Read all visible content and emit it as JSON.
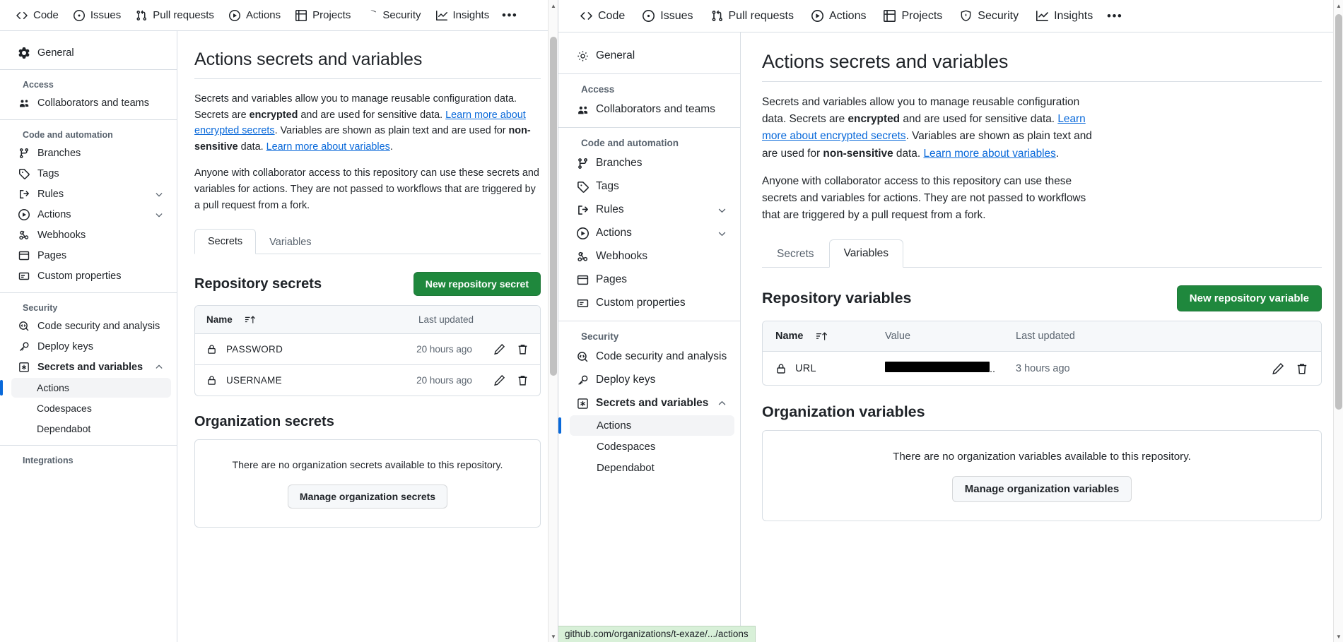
{
  "repo_nav": {
    "items": [
      {
        "label": "Code",
        "icon": "code-icon"
      },
      {
        "label": "Issues",
        "icon": "issue-opened-icon"
      },
      {
        "label": "Pull requests",
        "icon": "git-pull-request-icon"
      },
      {
        "label": "Actions",
        "icon": "play-icon"
      },
      {
        "label": "Projects",
        "icon": "table-icon"
      },
      {
        "label": "Security",
        "icon": "shield-icon"
      },
      {
        "label": "Insights",
        "icon": "graph-icon"
      }
    ],
    "more_label": "•••"
  },
  "sidebar": {
    "general": {
      "label": "General",
      "icon": "gear-icon"
    },
    "groups": [
      {
        "label": "Access",
        "items": [
          {
            "label": "Collaborators and teams",
            "icon": "people-icon",
            "chevron": false
          }
        ]
      },
      {
        "label": "Code and automation",
        "items": [
          {
            "label": "Branches",
            "icon": "git-branch-icon",
            "chevron": false
          },
          {
            "label": "Tags",
            "icon": "tag-icon",
            "chevron": false
          },
          {
            "label": "Rules",
            "icon": "rules-icon",
            "chevron": true
          },
          {
            "label": "Actions",
            "icon": "play-icon",
            "chevron": true
          },
          {
            "label": "Webhooks",
            "icon": "webhook-icon",
            "chevron": false
          },
          {
            "label": "Pages",
            "icon": "browser-icon",
            "chevron": false
          },
          {
            "label": "Custom properties",
            "icon": "note-icon",
            "chevron": false
          }
        ]
      },
      {
        "label": "Security",
        "items": [
          {
            "label": "Code security and analysis",
            "icon": "codescan-icon",
            "chevron": false
          },
          {
            "label": "Deploy keys",
            "icon": "key-icon",
            "chevron": false
          },
          {
            "label": "Secrets and variables",
            "icon": "asterisk-icon",
            "chevron": true,
            "bold": true
          }
        ],
        "subitems": [
          {
            "label": "Actions",
            "active": true
          },
          {
            "label": "Codespaces",
            "active": false
          },
          {
            "label": "Dependabot",
            "active": false
          }
        ]
      },
      {
        "label": "Integrations",
        "items": []
      }
    ]
  },
  "page": {
    "title": "Actions secrets and variables",
    "desc1_a": "Secrets and variables allow you to manage reusable configuration data. Secrets are ",
    "desc1_b": "encrypted",
    "desc1_c": " and are used for sensitive data. ",
    "desc1_link1": "Learn more about encrypted secrets",
    "desc1_d": ". Variables are shown as plain text and are used for ",
    "desc1_e": "non-sensitive",
    "desc1_f": " data. ",
    "desc1_link2": "Learn more about variables",
    "desc1_g": ".",
    "desc2": "Anyone with collaborator access to this repository can use these secrets and variables for actions. They are not passed to workflows that are triggered by a pull request from a fork."
  },
  "tabs": {
    "secrets": "Secrets",
    "variables": "Variables"
  },
  "left_panel": {
    "active_tab": "Secrets",
    "secrets_section": {
      "title": "Repository secrets",
      "new_button": "New repository secret",
      "columns": {
        "name": "Name",
        "last_updated": "Last updated"
      },
      "rows": [
        {
          "name": "PASSWORD",
          "last_updated": "20 hours ago",
          "icon": "lock-icon"
        },
        {
          "name": "USERNAME",
          "last_updated": "20 hours ago",
          "icon": "lock-icon"
        }
      ]
    },
    "org_section": {
      "title": "Organization secrets",
      "empty_text": "There are no organization secrets available to this repository.",
      "manage_button": "Manage organization secrets"
    }
  },
  "right_panel": {
    "active_tab": "Variables",
    "variables_section": {
      "title": "Repository variables",
      "new_button": "New repository variable",
      "columns": {
        "name": "Name",
        "value": "Value",
        "last_updated": "Last updated"
      },
      "rows": [
        {
          "name": "URL",
          "value": "",
          "value_redacted": true,
          "value_suffix": "..",
          "last_updated": "3 hours ago",
          "icon": "lock-icon"
        }
      ]
    },
    "org_section": {
      "title": "Organization variables",
      "empty_text": "There are no organization variables available to this repository.",
      "manage_button": "Manage organization variables"
    }
  },
  "status_bar": {
    "url": "github.com/organizations/t-exaze/.../actions"
  },
  "row_actions": {
    "edit": "pencil-icon",
    "delete": "trash-icon"
  },
  "colors": {
    "accent_green": "#1f883d",
    "link_blue": "#0969da",
    "active_marker": "#0969da",
    "status_bg": "#d8f0d8"
  }
}
